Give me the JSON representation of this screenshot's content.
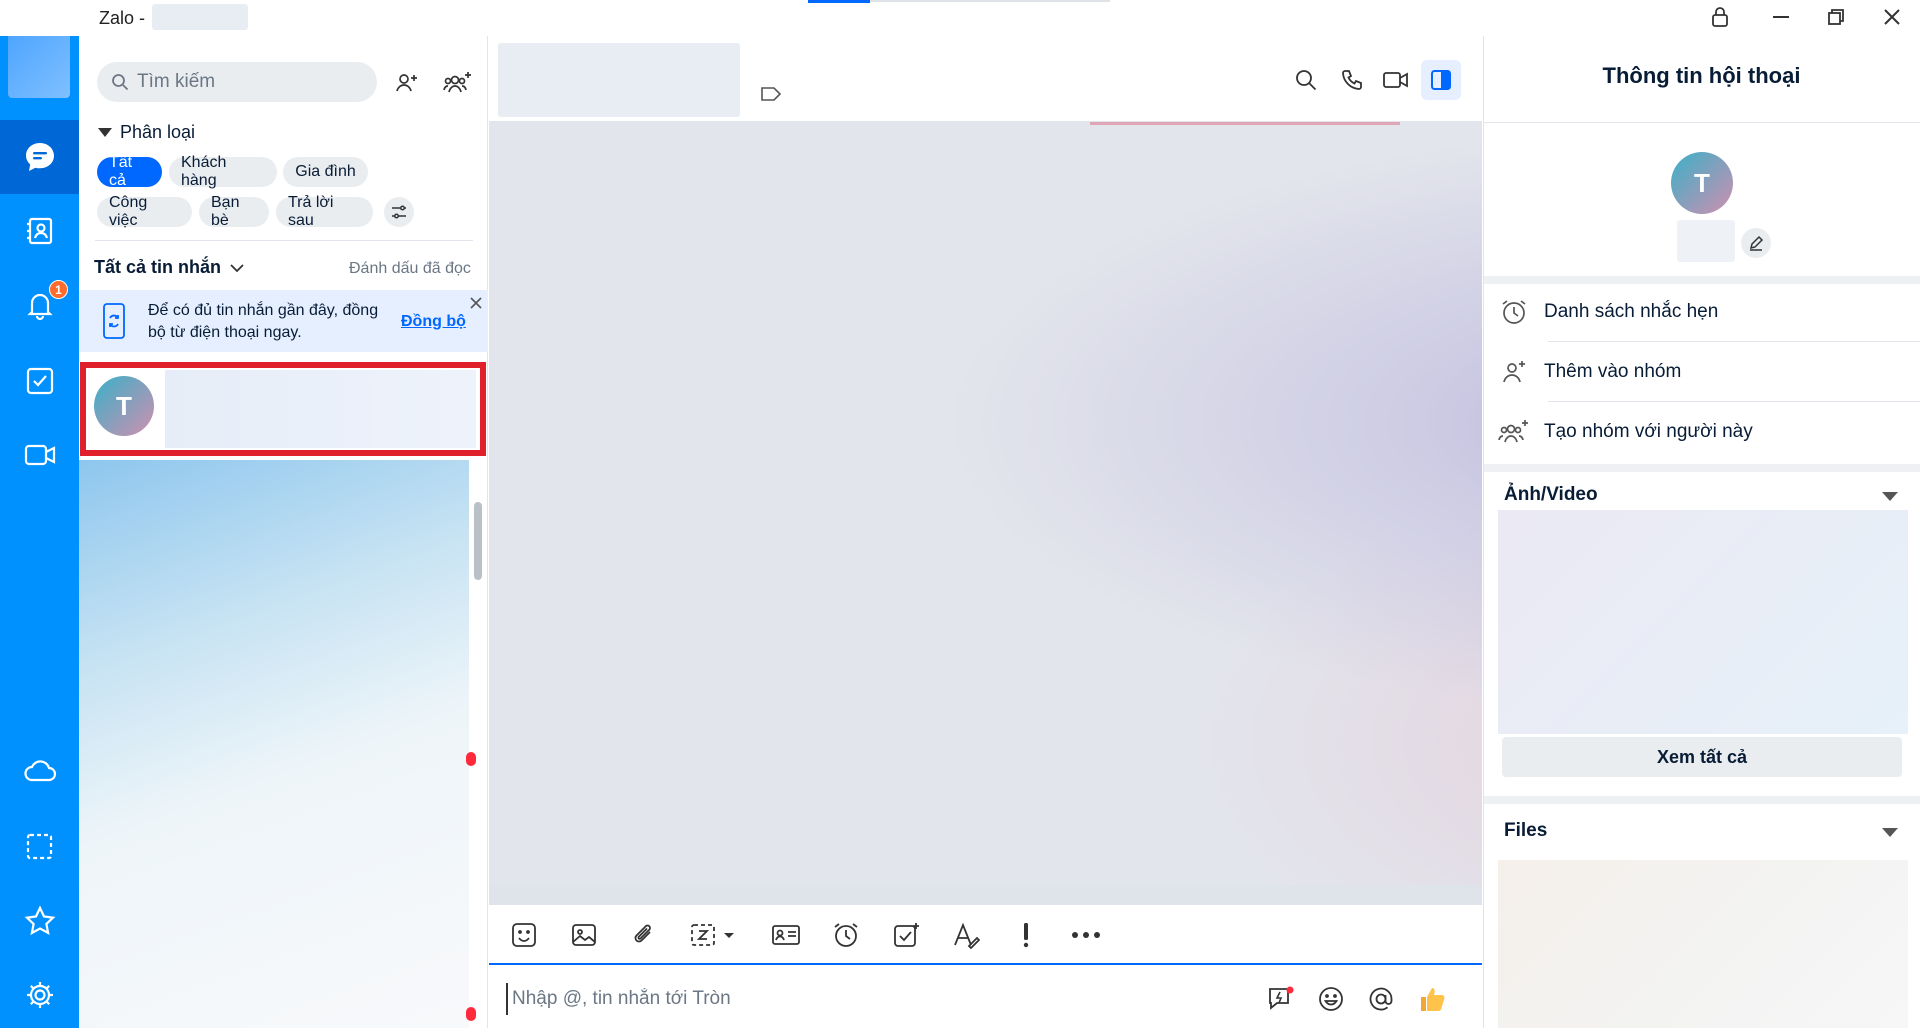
{
  "window": {
    "title": "Zalo -",
    "controls": [
      "lock-icon",
      "minimize-icon",
      "restore-icon",
      "close-icon"
    ]
  },
  "nav": {
    "items": [
      {
        "name": "messages",
        "icon": "chat-bubble-icon",
        "active": true
      },
      {
        "name": "contacts",
        "icon": "contact-book-icon"
      },
      {
        "name": "notifications",
        "icon": "bell-icon",
        "badge": "1"
      },
      {
        "name": "todo",
        "icon": "checkbox-icon"
      },
      {
        "name": "video-call",
        "icon": "video-icon"
      },
      {
        "name": "cloud",
        "icon": "cloud-icon"
      },
      {
        "name": "screenshot",
        "icon": "capture-icon"
      },
      {
        "name": "favorites",
        "icon": "star-icon"
      },
      {
        "name": "settings",
        "icon": "gear-icon"
      }
    ],
    "accent": "#0091ff"
  },
  "list": {
    "search_placeholder": "Tìm kiếm",
    "classify_label": "Phân loại",
    "chips": [
      "Tất cả",
      "Khách hàng",
      "Gia đình",
      "Công việc",
      "Bạn bè",
      "Trả lời sau"
    ],
    "all_messages": "Tất cả tin nhắn",
    "mark_read": "Đánh dấu đã đọc",
    "sync_text": "Để có đủ tin nhắn gần đây, đồng bộ từ điện thoại ngay.",
    "sync_link": "Đồng bộ",
    "selected_avatar_letter": "T"
  },
  "chat": {
    "input_placeholder": "Nhập @, tin nhắn tới Tròn",
    "header_icons": [
      "search-icon",
      "phone-icon",
      "video-camera-icon",
      "side-panel-icon"
    ],
    "toolbar_icons": [
      "sticker-icon",
      "image-icon",
      "attachment-icon",
      "zalo-screenshot-icon",
      "business-card-icon",
      "reminder-icon",
      "task-icon",
      "text-format-icon",
      "important-icon",
      "more-icon"
    ],
    "input_icons": [
      "quick-message-icon",
      "emoji-icon",
      "mention-icon",
      "thumbs-up-icon"
    ]
  },
  "info": {
    "title": "Thông tin hội thoại",
    "avatar_letter": "T",
    "rows": [
      {
        "icon": "alarm-clock-icon",
        "label": "Danh sách nhắc hẹn"
      },
      {
        "icon": "add-to-group-icon",
        "label": "Thêm vào nhóm"
      },
      {
        "icon": "create-group-icon",
        "label": "Tạo nhóm với người này"
      }
    ],
    "media_section": "Ảnh/Video",
    "see_all": "Xem tất cả",
    "files_section": "Files"
  }
}
